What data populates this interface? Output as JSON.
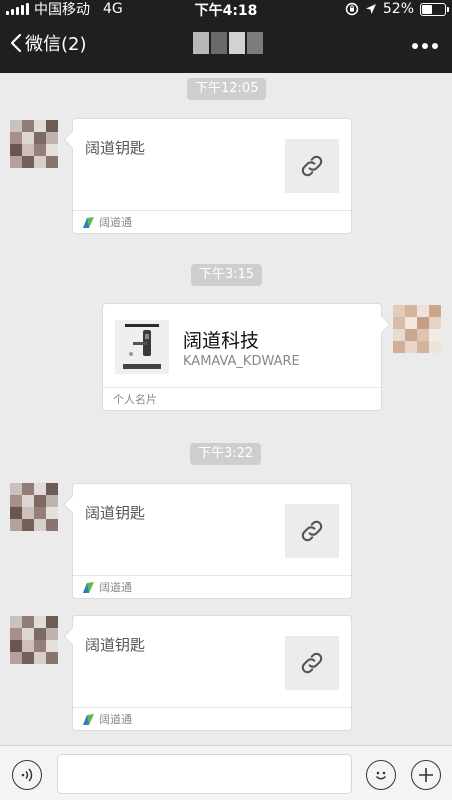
{
  "status_bar": {
    "carrier": "中国移动",
    "network": "4G",
    "time": "下午4:18",
    "battery_percent": "52%",
    "battery_level": 0.52
  },
  "nav": {
    "back_label": "微信(2)",
    "more_icon": "more-dots-icon"
  },
  "colors": {
    "nav_bg": "#1f1f1f",
    "chat_bg": "#ebebeb",
    "time_pill_bg": "#cecece"
  },
  "messages": [
    {
      "type": "time",
      "text": "下午12:05"
    },
    {
      "type": "link",
      "side": "left",
      "title": "阔道钥匙",
      "source": "阔道通",
      "icon": "link-icon"
    },
    {
      "type": "time",
      "text": "下午3:15"
    },
    {
      "type": "contact_card",
      "side": "right",
      "name": "阔道科技",
      "id": "KAMAVA_KDWARE",
      "footer": "个人名片"
    },
    {
      "type": "time",
      "text": "下午3:22"
    },
    {
      "type": "link",
      "side": "left",
      "title": "阔道钥匙",
      "source": "阔道通",
      "icon": "link-icon"
    },
    {
      "type": "link",
      "side": "left",
      "title": "阔道钥匙",
      "source": "阔道通",
      "icon": "link-icon"
    }
  ],
  "input_bar": {
    "voice_icon": "voice-icon",
    "text_value": "",
    "emoji_icon": "emoji-icon",
    "plus_icon": "plus-icon"
  }
}
